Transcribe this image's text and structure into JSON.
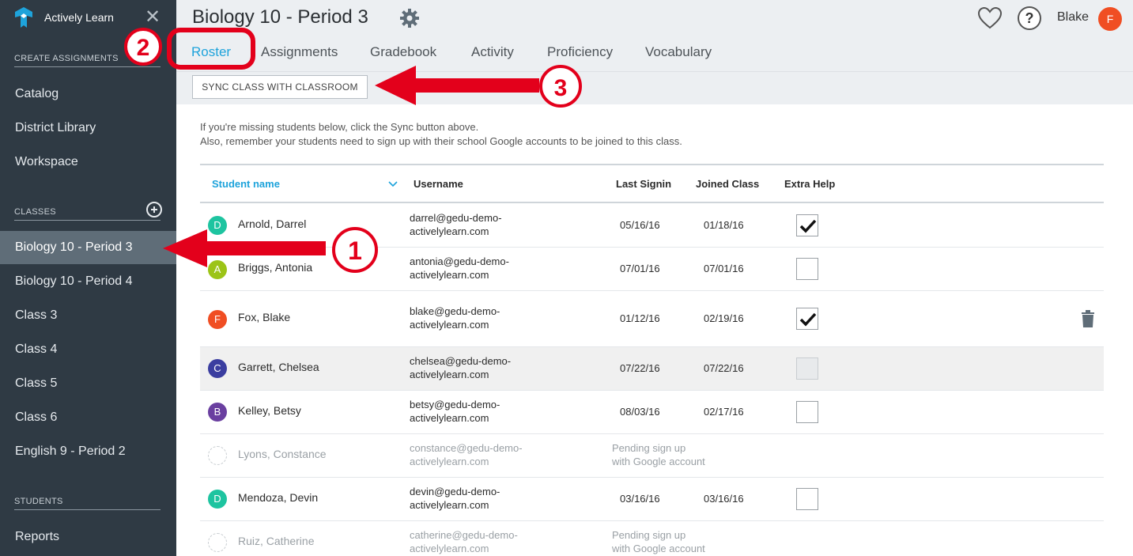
{
  "app": {
    "name": "Actively Learn"
  },
  "sidebar": {
    "create_header": "CREATE ASSIGNMENTS",
    "create_items": [
      {
        "label": "Catalog"
      },
      {
        "label": "District Library"
      },
      {
        "label": "Workspace"
      }
    ],
    "classes_header": "CLASSES",
    "classes": [
      {
        "label": "Biology 10 - Period 3",
        "active": true
      },
      {
        "label": "Biology 10 - Period 4"
      },
      {
        "label": "Class 3"
      },
      {
        "label": "Class 4"
      },
      {
        "label": "Class 5"
      },
      {
        "label": "Class 6"
      },
      {
        "label": "English 9 - Period 2"
      }
    ],
    "students_header": "STUDENTS",
    "students_items": [
      {
        "label": "Reports"
      }
    ]
  },
  "header": {
    "title": "Biology 10 - Period 3",
    "user_name": "Blake",
    "user_initial": "F",
    "help_glyph": "?",
    "close_glyph": "✕",
    "tabs": [
      {
        "label": "Roster",
        "active": true
      },
      {
        "label": "Assignments"
      },
      {
        "label": "Gradebook"
      },
      {
        "label": "Activity"
      },
      {
        "label": "Proficiency"
      },
      {
        "label": "Vocabulary"
      }
    ]
  },
  "sync": {
    "button_label": "SYNC CLASS WITH CLASSROOM"
  },
  "info": {
    "line1": "If you're missing students below, click the Sync button above.",
    "line2": "Also, remember your students need to sign up with their school Google accounts to be joined to this class."
  },
  "roster": {
    "columns": [
      "Student name",
      "Username",
      "Last Signin",
      "Joined Class",
      "Extra Help"
    ],
    "rows": [
      {
        "initial": "D",
        "color": "#1ec4a0",
        "name": "Arnold, Darrel",
        "username_1": "darrel@gedu-demo-",
        "username_2": "activelylearn.com",
        "last_signin": "05/16/16",
        "joined": "01/18/16",
        "extra_help": true
      },
      {
        "initial": "A",
        "color": "#9cc417",
        "name": "Briggs, Antonia",
        "username_1": "antonia@gedu-demo-",
        "username_2": "activelylearn.com",
        "last_signin": "07/01/16",
        "joined": "07/01/16",
        "extra_help": false
      },
      {
        "initial": "F",
        "color": "#f04e23",
        "name": "Fox, Blake",
        "username_1": "blake@gedu-demo-",
        "username_2": "activelylearn.com",
        "last_signin": "01/12/16",
        "joined": "02/19/16",
        "extra_help": true
      },
      {
        "initial": "C",
        "color": "#3b3ea0",
        "name": "Garrett, Chelsea",
        "username_1": "chelsea@gedu-demo-",
        "username_2": "activelylearn.com",
        "last_signin": "07/22/16",
        "joined": "07/22/16",
        "extra_help": false
      },
      {
        "initial": "B",
        "color": "#6a3fa0",
        "name": "Kelley, Betsy",
        "username_1": "betsy@gedu-demo-",
        "username_2": "activelylearn.com",
        "last_signin": "08/03/16",
        "joined": "02/17/16",
        "extra_help": false
      },
      {
        "initial": "",
        "name": "Lyons, Constance",
        "username_1": "constance@gedu-demo-",
        "username_2": "activelylearn.com",
        "pending_1": "Pending sign up",
        "pending_2": "with Google account"
      },
      {
        "initial": "D",
        "color": "#1ec4a0",
        "name": "Mendoza, Devin",
        "username_1": "devin@gedu-demo-",
        "username_2": "activelylearn.com",
        "last_signin": "03/16/16",
        "joined": "03/16/16",
        "extra_help": false
      },
      {
        "initial": "",
        "name": "Ruiz, Catherine",
        "username_1": "catherine@gedu-demo-",
        "username_2": "activelylearn.com",
        "pending_1": "Pending sign up",
        "pending_2": "with Google account"
      }
    ]
  },
  "annotations": [
    {
      "number": "1",
      "color": "#e3001b"
    },
    {
      "number": "2",
      "color": "#e3001b"
    },
    {
      "number": "3",
      "color": "#e3001b"
    }
  ]
}
